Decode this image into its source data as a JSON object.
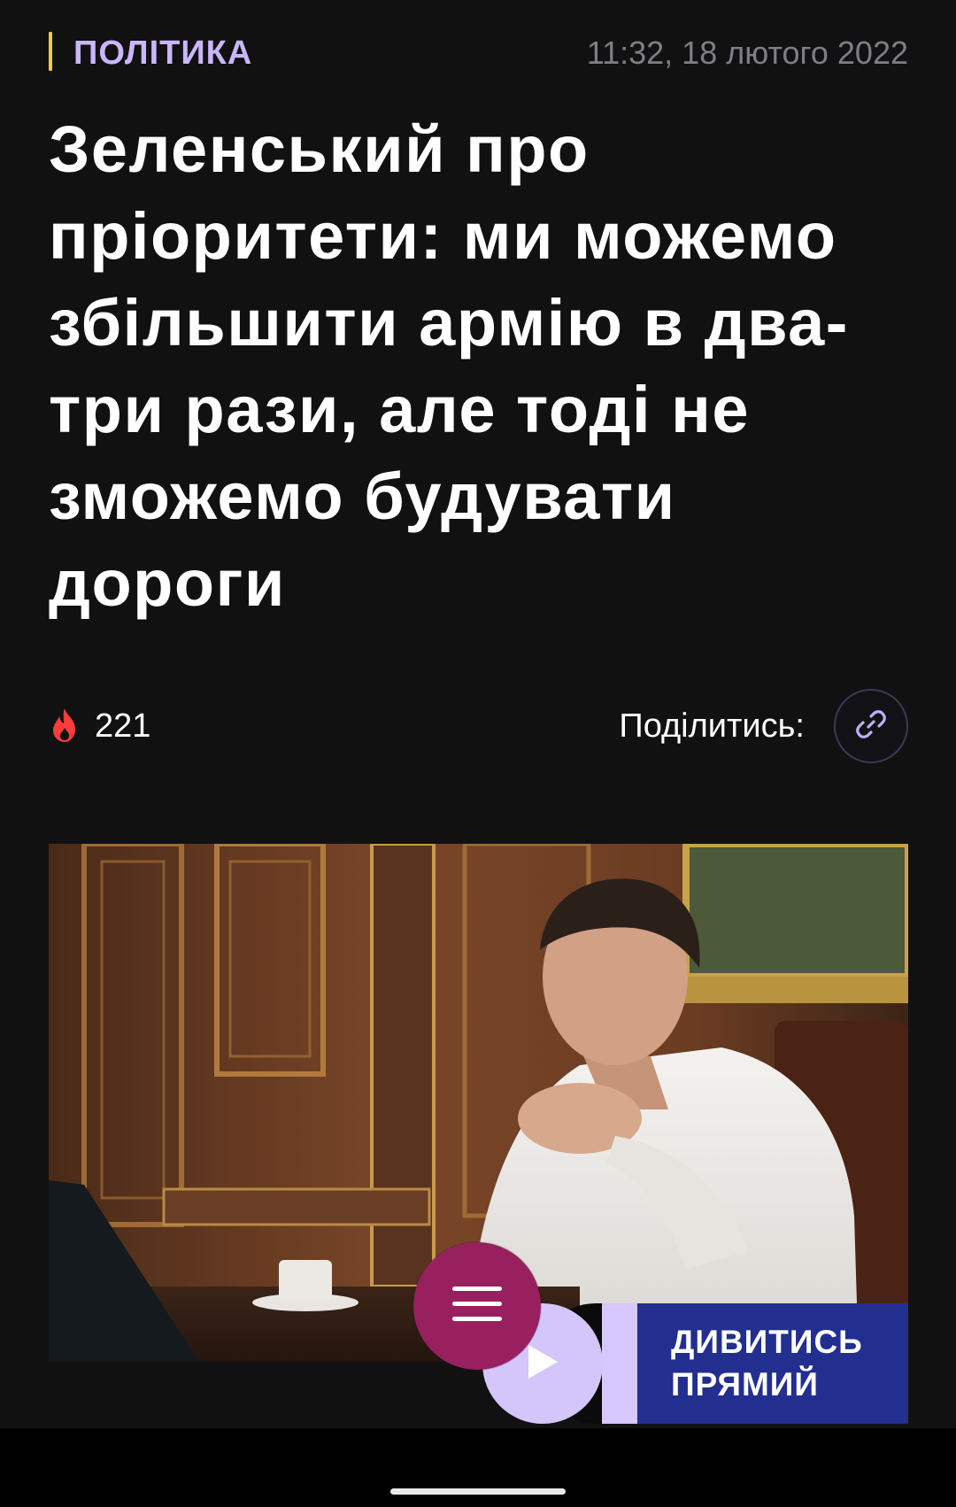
{
  "article": {
    "category": "ПОЛІТИКА",
    "timestamp": "11:32, 18 лютого 2022",
    "headline": "Зеленський про пріоритети: ми можемо збільшити армію в два-три рази, але тоді не зможемо будувати дороги",
    "views_icon": "fire-icon",
    "views": "221",
    "share_label": "Поділитись:",
    "share_icon": "link-icon"
  },
  "colors": {
    "background": "#111112",
    "category": "#c9b6ff",
    "category_bar": "#f4c93c",
    "timestamp": "#7e7e86",
    "fire": "#ff3b3b",
    "menu_button": "#98205f",
    "live_banner": "#222f8f",
    "play_button": "#d4c6fb"
  },
  "floating": {
    "menu_icon": "hamburger-menu-icon",
    "play_icon": "play-icon",
    "live_label": "ДИВИТИСЬ\nПРЯМИЙ"
  }
}
